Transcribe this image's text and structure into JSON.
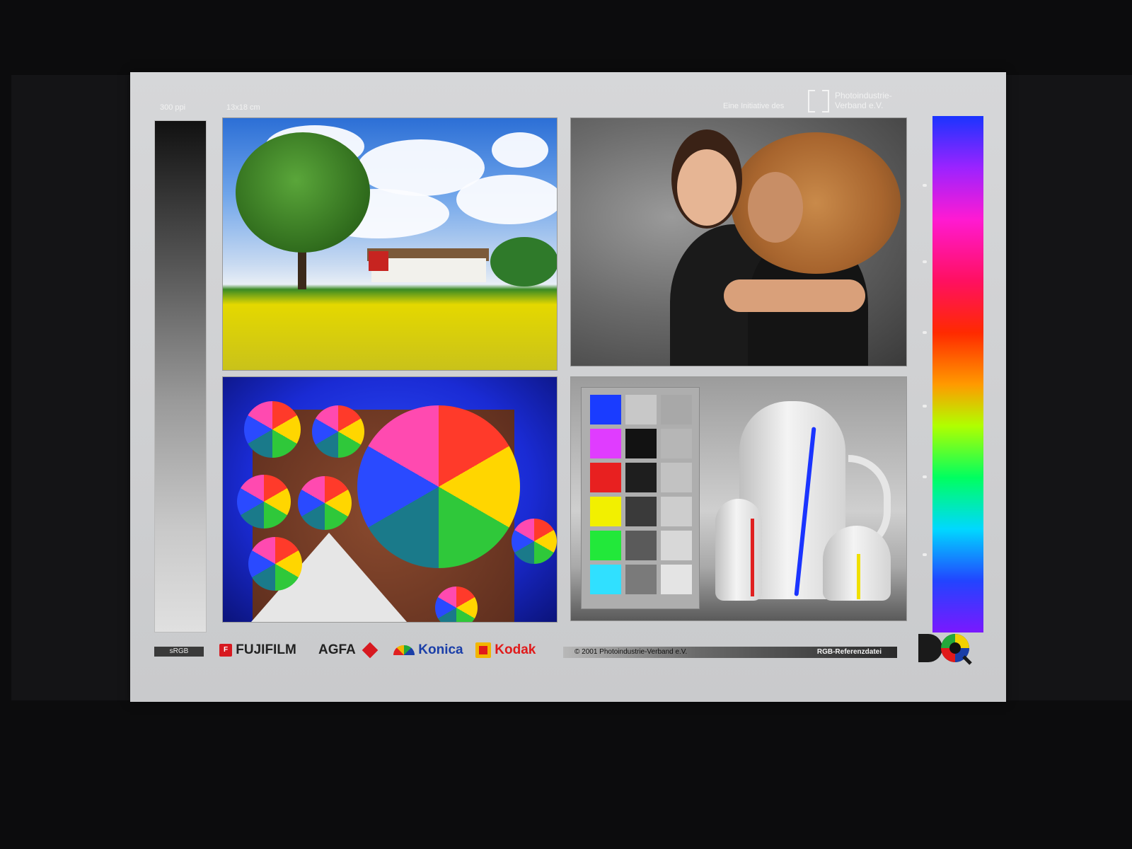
{
  "header": {
    "resolution": "300 ppi",
    "size": "13x18 cm",
    "initiative": "Eine Initiative des",
    "org_line1": "Photoindustrie-",
    "org_line2": "Verband e.V."
  },
  "footer": {
    "color_space": "sRGB",
    "brands": [
      "FUJIFILM",
      "AGFA",
      "Konica",
      "Kodak"
    ],
    "copyright": "© 2001  Photoindustrie-Verband e.V.",
    "file_label": "RGB-Referenzdatei"
  },
  "colors": {
    "swatches_left": [
      "#1a3cff",
      "#e03cff",
      "#e82020",
      "#f2f000",
      "#22e83a",
      "#30e0ff"
    ],
    "swatches_mid": [
      "#c8c8c8",
      "#121212",
      "#1e1e1e",
      "#3a3a3a",
      "#5a5a5a",
      "#7a7a7a"
    ],
    "swatches_right": [
      "#a8a8a8",
      "#b6b6b6",
      "#c2c2c2",
      "#cdcdcd",
      "#d8d8d8",
      "#e4e4e4"
    ],
    "fujifilm_red": "#d71920",
    "konica_blue": "#1a3ea8",
    "kodak_red": "#e01a1a",
    "kodak_yellow": "#f2b600"
  },
  "icons": [
    "pvd-bracket-icon",
    "fujifilm-logo-icon",
    "agfa-rhombus-icon",
    "konica-rainbow-icon",
    "kodak-logo-icon",
    "dq-logo-icon"
  ]
}
